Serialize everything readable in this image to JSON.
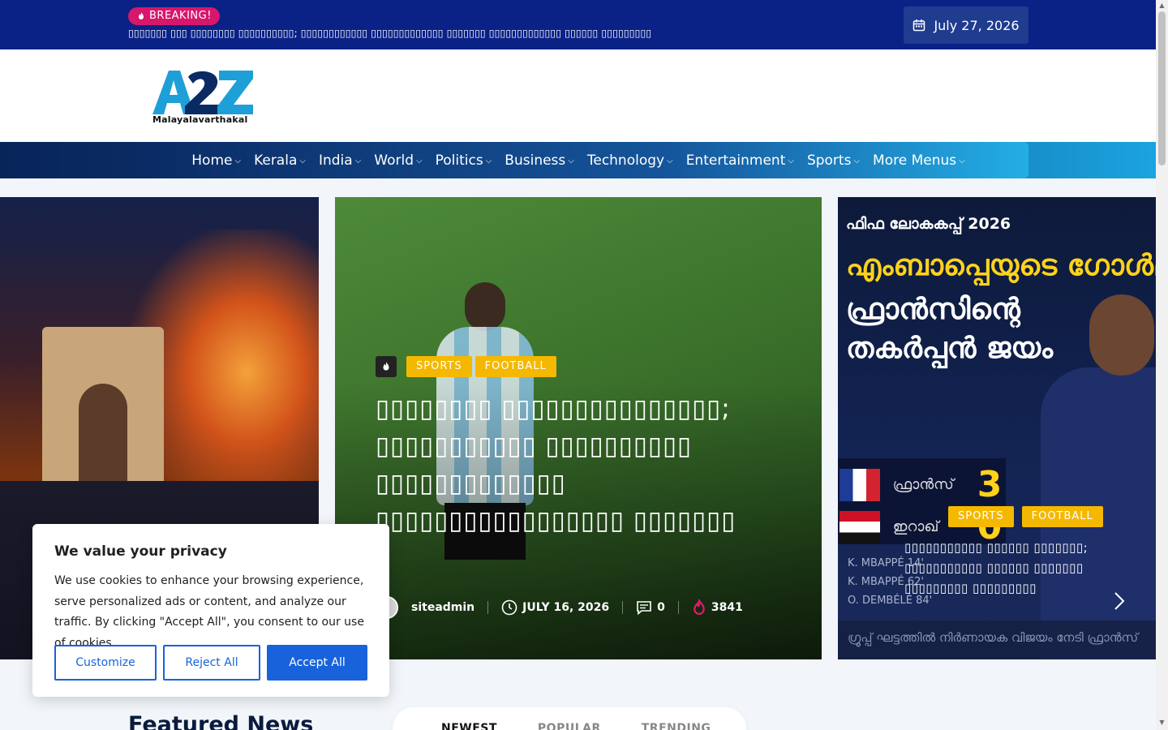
{
  "topbar": {
    "breaking_label": "BREAKING!",
    "breaking_text": "▯▯▯▯▯▯▯ ▯▯▯ ▯▯▯▯▯▯▯▯ ▯▯▯▯▯▯▯▯▯▯; ▯▯▯▯▯▯▯▯▯▯▯▯ ▯▯▯▯▯▯▯▯▯▯▯▯▯ ▯▯▯▯▯▯▯ ▯▯▯▯▯▯▯▯▯▯▯▯▯ ▯▯▯▯▯▯ ▯▯▯▯▯▯▯▯▯",
    "date": "July 27, 2026"
  },
  "logo": {
    "mark": "A2Z",
    "caption": "Malayalavarthakal"
  },
  "nav": {
    "items": [
      {
        "label": "Home"
      },
      {
        "label": "Kerala"
      },
      {
        "label": "India"
      },
      {
        "label": "World"
      },
      {
        "label": "Politics"
      },
      {
        "label": "Business"
      },
      {
        "label": "Technology"
      },
      {
        "label": "Entertainment"
      },
      {
        "label": "Sports"
      },
      {
        "label": "More Menus"
      }
    ]
  },
  "hero": {
    "center": {
      "tags": [
        "SPORTS",
        "FOOTBALL"
      ],
      "title": "▯▯▯▯▯▯▯▯ ▯▯▯▯▯▯▯▯▯▯▯▯▯▯▯; ▯▯▯▯▯▯▯▯▯▯▯ ▯▯▯▯▯▯▯▯▯▯ ▯▯▯▯▯▯▯▯▯▯▯▯▯ ▯▯▯▯▯▯▯▯▯▯▯▯▯▯▯▯▯ ▯▯▯▯▯▯▯",
      "author": "siteadmin",
      "date": "JULY 16, 2026",
      "comments": "0",
      "views": "3841"
    },
    "right": {
      "eyebrow": "ഫിഫ ലോകകപ്പ് 2026",
      "headline_yellow": "എംബാപ്പെയുടെ ഗോൾമ",
      "headline_white": "ഫ്രാൻസിന്റെ തകർപ്പൻ ജയം",
      "score": [
        {
          "team": "ഫ്രാൻസ്",
          "goals": "3"
        },
        {
          "team": "ഇറാഖ്",
          "goals": "0"
        }
      ],
      "scorers": [
        "K. MBAPPÉ   14'",
        "K. MBAPPÉ   62'",
        "O. DEMBÉLÉ   84'"
      ],
      "tags": [
        "SPORTS",
        "FOOTBALL"
      ],
      "title": "▯▯▯▯▯▯▯▯▯▯▯ ▯▯▯▯▯▯ ▯▯▯▯▯▯▯; ▯▯▯▯▯▯▯▯▯▯▯ ▯▯▯▯▯▯ ▯▯▯▯▯▯▯ ▯▯▯▯▯▯▯▯▯ ▯▯▯▯▯▯▯▯▯",
      "footer": "ഗ്രൂപ്പ് ഘട്ടത്തിൽ നിർണായക വിജയം നേടി ഫ്രാൻസ്"
    }
  },
  "featured": {
    "title": "Featured News",
    "tabs": [
      "NEWEST",
      "POPULAR",
      "TRENDING"
    ]
  },
  "cookie": {
    "title": "We value your privacy",
    "body": "We use cookies to enhance your browsing experience, serve personalized ads or content, and analyze our traffic. By clicking \"Accept All\", you consent to our use of cookies.",
    "customize": "Customize",
    "reject": "Reject All",
    "accept": "Accept All"
  },
  "colors": {
    "topbar": "#0a2186",
    "breaking_badge": "#d6176b",
    "tag": "#f5b800",
    "accent_button": "#1863dc",
    "headline_yellow": "#ffd21a"
  },
  "icons": {
    "breaking": "fire-icon",
    "date": "calendar-icon",
    "nav_dropdown": "chevron-down-icon",
    "time": "clock-icon",
    "comments": "comment-icon",
    "views": "fire-icon",
    "slider_next": "chevron-right-icon"
  }
}
